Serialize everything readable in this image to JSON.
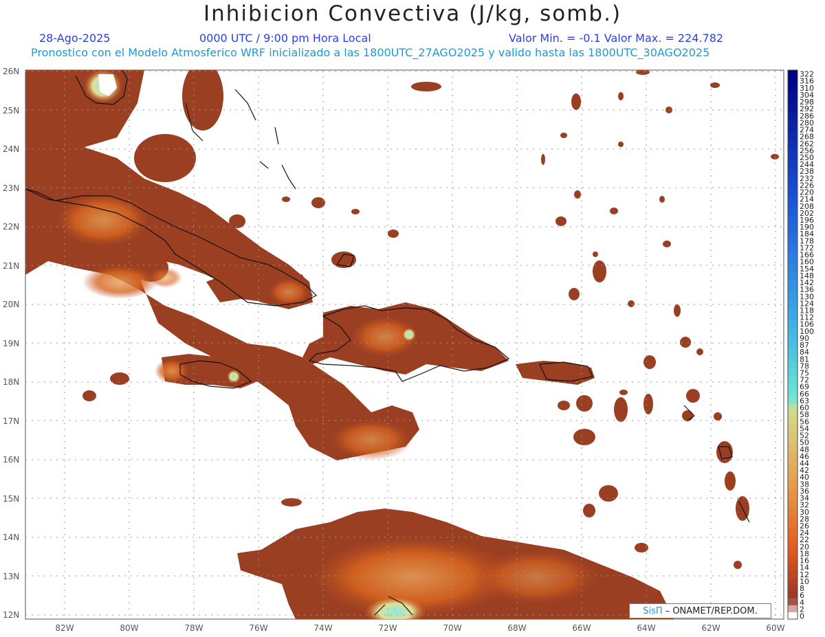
{
  "header": {
    "title": "Inhibicion Convectiva (J/kg, somb.)",
    "date": "28-Ago-2025",
    "time": "0000 UTC / 9:00 pm Hora Local",
    "minmax": "Valor Min. = -0.1  Valor Max. = 224.782",
    "forecast": "Pronostico con el Modelo Atmosferico WRF inicializado a las 1800UTC_27AGO2025 y valido hasta las  1800UTC_30AGO2025"
  },
  "axes": {
    "lat_labels": [
      "26N",
      "25N",
      "24N",
      "23N",
      "22N",
      "21N",
      "20N",
      "19N",
      "18N",
      "17N",
      "16N",
      "15N",
      "14N",
      "13N",
      "12N"
    ],
    "lon_labels": [
      "82W",
      "80W",
      "78W",
      "76W",
      "74W",
      "72W",
      "70W",
      "68W",
      "66W",
      "64W",
      "62W",
      "60W"
    ]
  },
  "colorbar": {
    "labels": [
      "322",
      "316",
      "310",
      "304",
      "298",
      "292",
      "286",
      "280",
      "274",
      "268",
      "262",
      "256",
      "250",
      "244",
      "238",
      "232",
      "226",
      "220",
      "214",
      "208",
      "202",
      "196",
      "190",
      "184",
      "178",
      "172",
      "166",
      "160",
      "154",
      "148",
      "142",
      "136",
      "130",
      "124",
      "118",
      "112",
      "106",
      "100",
      "90",
      "87",
      "84",
      "81",
      "78",
      "75",
      "72",
      "69",
      "66",
      "63",
      "60",
      "58",
      "56",
      "54",
      "52",
      "50",
      "48",
      "46",
      "44",
      "42",
      "40",
      "38",
      "36",
      "34",
      "32",
      "30",
      "28",
      "26",
      "24",
      "22",
      "20",
      "18",
      "16",
      "14",
      "12",
      "10",
      "8",
      "6",
      "4",
      "2",
      "0"
    ]
  },
  "credit": {
    "brand": "SisΠ",
    "text": "– ONAMET/REP.DOM."
  },
  "colors": {
    "shade_dark": "#8e3a22",
    "shade_mid": "#b44a22",
    "shade_hot": "#e06a1a",
    "shade_light": "#e6b46a",
    "shade_cyan": "#86e6d6"
  }
}
